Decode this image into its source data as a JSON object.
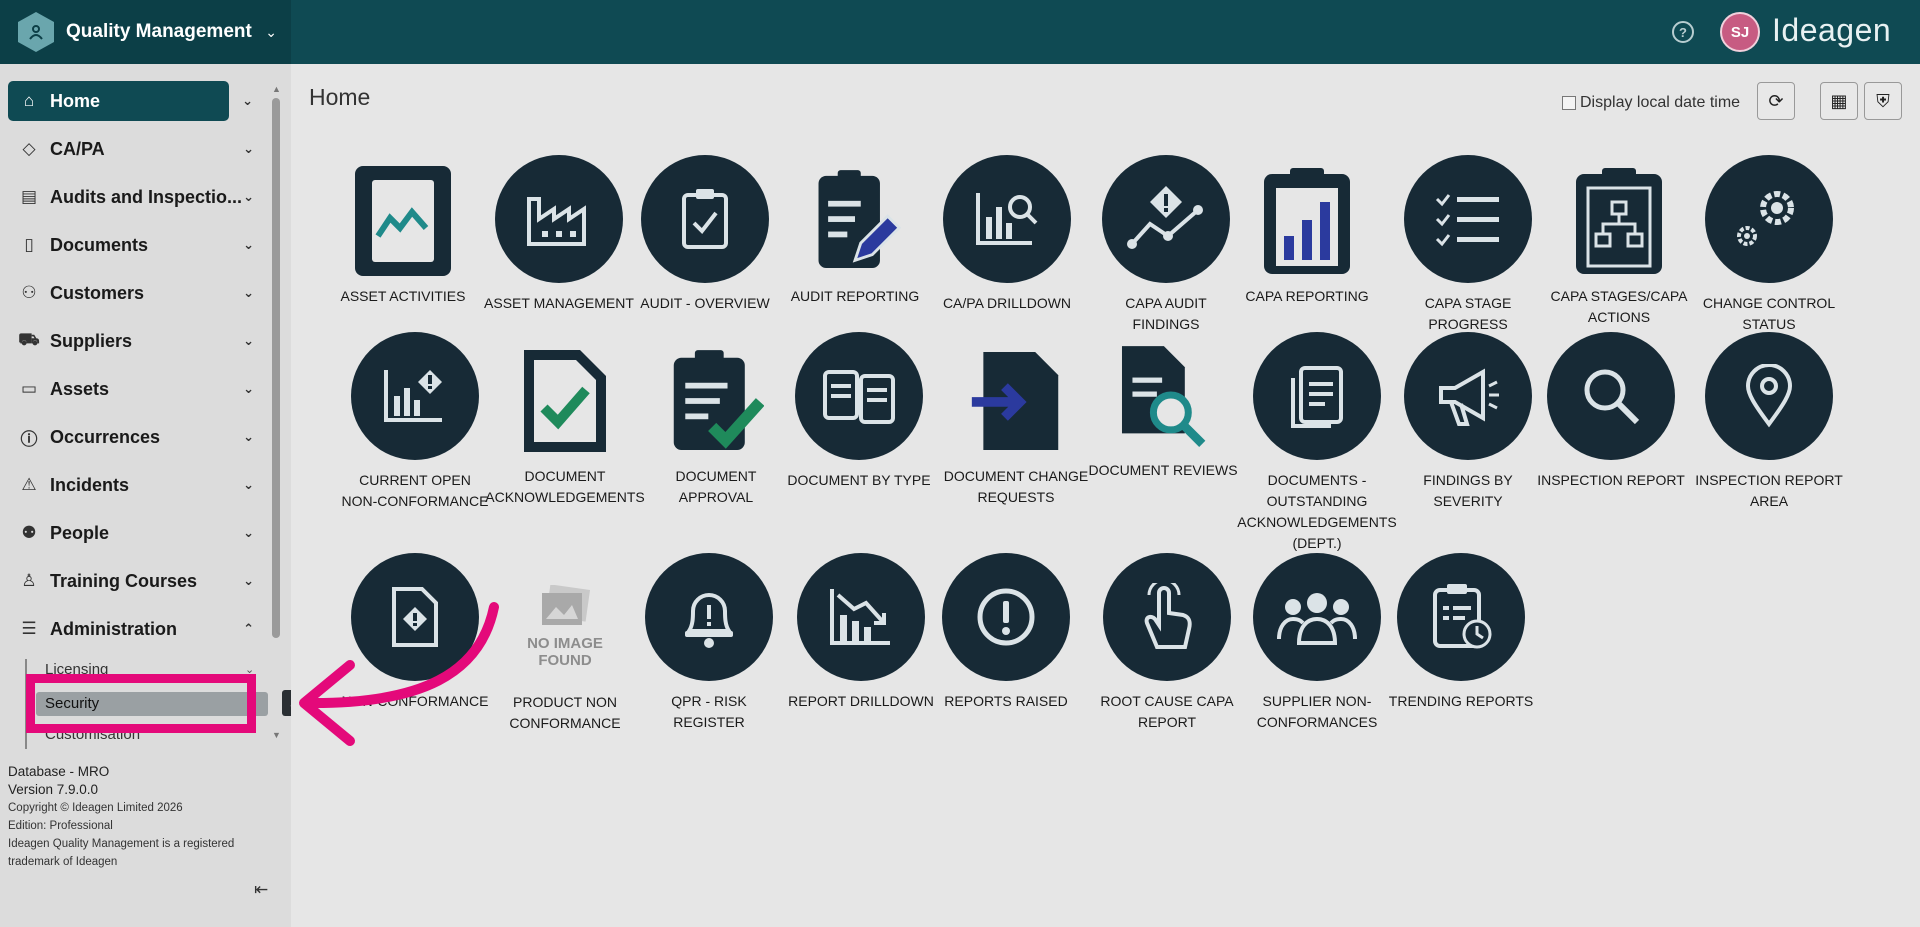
{
  "header": {
    "app_title": "Quality Management",
    "brand": "Ideagen",
    "avatar_initials": "SJ",
    "help_icon": "help-circle-icon"
  },
  "sidebar": {
    "items": [
      {
        "label": "Home",
        "icon": "home-icon",
        "active": true
      },
      {
        "label": "CA/PA",
        "icon": "diamond-icon"
      },
      {
        "label": "Audits and Inspectio...",
        "icon": "clipboard-icon"
      },
      {
        "label": "Documents",
        "icon": "document-icon"
      },
      {
        "label": "Customers",
        "icon": "users-icon"
      },
      {
        "label": "Suppliers",
        "icon": "cart-icon"
      },
      {
        "label": "Assets",
        "icon": "archive-icon"
      },
      {
        "label": "Occurrences",
        "icon": "alert-circle-icon"
      },
      {
        "label": "Incidents",
        "icon": "warning-icon"
      },
      {
        "label": "People",
        "icon": "people-icon"
      },
      {
        "label": "Training Courses",
        "icon": "training-icon"
      },
      {
        "label": "Administration",
        "icon": "sliders-icon",
        "expanded": true
      }
    ],
    "sub_items": {
      "licensing": "Licensing",
      "security": "Security",
      "customisation": "Customisation"
    },
    "tooltip": "Se",
    "footer": {
      "database": "Database - MRO",
      "version": "Version 7.9.0.0",
      "copyright": "Copyright © Ideagen Limited 2026",
      "edition": "Edition: Professional",
      "trademark": "Ideagen Quality Management is a registered trademark of Ideagen"
    }
  },
  "main": {
    "page_title": "Home",
    "display_local_label": "Display local date time",
    "tiles_row1": [
      "ASSET ACTIVITIES",
      "ASSET MANAGEMENT",
      "AUDIT - OVERVIEW",
      "AUDIT REPORTING",
      "CA/PA DRILLDOWN",
      "CAPA AUDIT FINDINGS",
      "CAPA REPORTING",
      "CAPA STAGE PROGRESS",
      "CAPA STAGES/CAPA ACTIONS",
      "CHANGE CONTROL STATUS"
    ],
    "tiles_row2": [
      "CURRENT OPEN NON-CONFORMANCE",
      "DOCUMENT ACKNOWLEDGEMENTS",
      "DOCUMENT APPROVAL",
      "DOCUMENT BY TYPE",
      "DOCUMENT CHANGE REQUESTS",
      "DOCUMENT REVIEWS",
      "DOCUMENTS - OUTSTANDING ACKNOWLEDGEMENTS (DEPT.)",
      "FINDINGS BY SEVERITY",
      "INSPECTION REPORT",
      "INSPECTION REPORT AREA"
    ],
    "tiles_row3": [
      "NON-CONFORMANCE",
      "PRODUCT NON CONFORMANCE",
      "QPR - RISK REGISTER",
      "REPORT DRILLDOWN",
      "REPORTS RAISED",
      "ROOT CAUSE CAPA REPORT",
      "SUPPLIER NON-CONFORMANCES",
      "TRENDING REPORTS"
    ],
    "no_image_text": "NO IMAGE FOUND"
  },
  "colors": {
    "topbar": "#0f4a53",
    "tile_dark": "#172a36",
    "highlight": "#e4097a",
    "accent_green": "#1f8a5b",
    "accent_blue": "#2b3a9e",
    "accent_teal": "#1f8a8a"
  }
}
